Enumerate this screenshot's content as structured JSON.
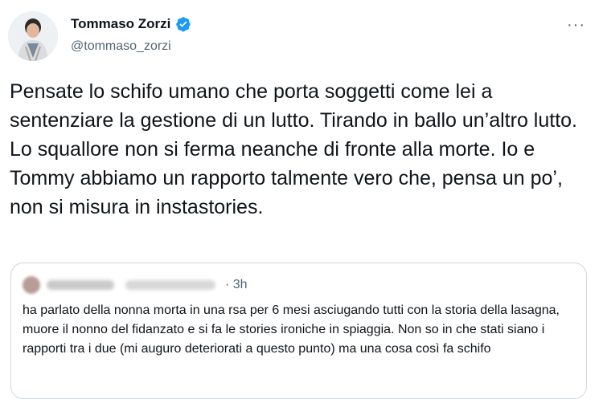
{
  "author": {
    "display_name": "Tommaso Zorzi",
    "handle": "@tommaso_zorzi",
    "verified_icon": "verified-badge-icon",
    "verified_color": "#1d9bf0"
  },
  "menu": {
    "more_label": "···"
  },
  "tweet": {
    "text": "Pensate lo schifo umano che porta soggetti come lei a sentenziare la gestione di un lutto. Tirando in ballo un’altro lutto. Lo squallore non si ferma neanche di fronte alla morte. Io e Tommy abbiamo un rapporto talmente vero che, pensa un po’, non si misura in instastories."
  },
  "quoted_tweet": {
    "time": "· 3h",
    "text": "ha parlato della nonna morta in una rsa per 6 mesi asciugando tutti con la storia della lasagna, muore il nonno del fidanzato e si fa le stories ironiche in spiaggia. Non so in che stati siano i rapporti tra i due (mi auguro deteriorati a questo punto) ma una cosa così fa schifo"
  }
}
